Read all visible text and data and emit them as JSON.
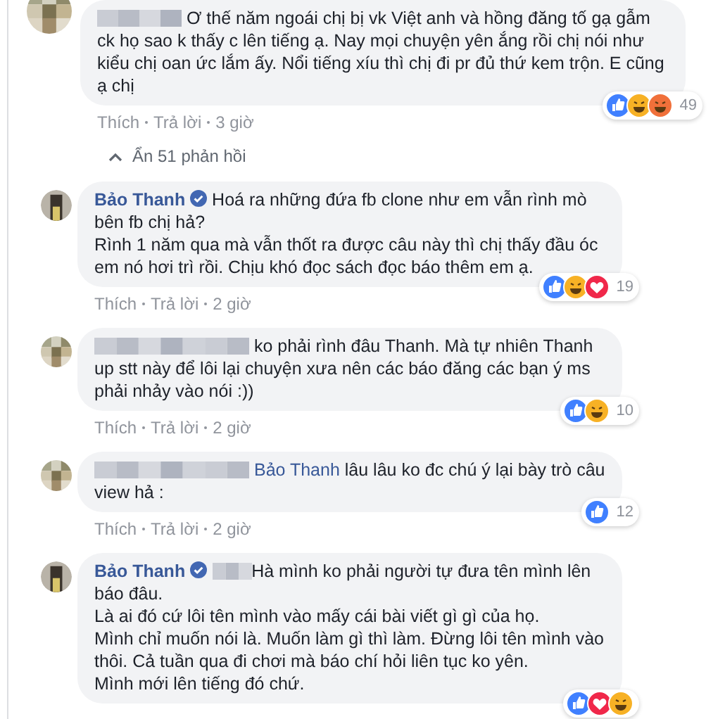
{
  "comments": [
    {
      "avatar": {
        "kind": "blurred"
      },
      "name_hidden": true,
      "verified": false,
      "text": "Ơ thế năm ngoái chị bị vk Việt anh và hồng đăng tố gạ gẫm ck họ sao k thấy c lên tiếng ạ. Nay mọi chuyện yên ắng rồi chị nói như kiểu chị oan ức lắm ấy. Nổi tiếng xíu thì chị đi pr đủ thứ kem trộn. E cũng ạ chị",
      "reactions": [
        {
          "kind": "like"
        },
        {
          "kind": "haha"
        },
        {
          "kind": "angry"
        }
      ],
      "reaction_count": "49",
      "actions": [
        "Thích",
        "Trả lời",
        "3 giờ"
      ],
      "replies_toggle": {
        "label": "Ẩn 51 phản hồi",
        "expanded": true
      },
      "children": [
        {
          "avatar": {
            "kind": "photo"
          },
          "name": "Bảo Thanh",
          "verified": true,
          "name_hidden": false,
          "text": "Hoá ra những đứa fb clone như em vẫn rình mò bên fb chị hả?\nRình 1 năm qua mà vẫn thốt ra được câu này thì chị thấy đầu óc em nó hơi trì rồi. Chịu khó đọc sách đọc báo thêm em ạ.",
          "reactions": [
            {
              "kind": "like"
            },
            {
              "kind": "haha"
            },
            {
              "kind": "love"
            }
          ],
          "reaction_count": "19",
          "actions": [
            "Thích",
            "Trả lời",
            "2 giờ"
          ]
        },
        {
          "avatar": {
            "kind": "blurred"
          },
          "name_hidden": true,
          "verified": false,
          "text": "ko phải rình đâu Thanh. Mà tự nhiên Thanh up stt này để lôi lại chuyện xưa nên các báo đăng các bạn ý ms phải nhảy vào nói :))",
          "reactions": [
            {
              "kind": "like"
            },
            {
              "kind": "haha"
            }
          ],
          "reaction_count": "10",
          "actions": [
            "Thích",
            "Trả lời",
            "2 giờ"
          ]
        },
        {
          "avatar": {
            "kind": "blurred"
          },
          "name_hidden": true,
          "verified": false,
          "mention": "Bảo Thanh",
          "text": "lâu lâu ko đc chú ý lại bày trò câu view hả :",
          "reactions": [
            {
              "kind": "like"
            }
          ],
          "reaction_count": "12",
          "actions": [
            "Thích",
            "Trả lời",
            "2 giờ"
          ]
        },
        {
          "avatar": {
            "kind": "photo"
          },
          "name": "Bảo Thanh",
          "verified": true,
          "name_hidden": false,
          "mention_hidden": true,
          "text": "Hà mình ko phải người tự đưa tên mình lên báo đâu.\nLà ai đó cứ lôi tên mình vào mấy cái bài viết gì gì của họ.\nMình chỉ muốn nói là. Muốn làm gì thì làm. Đừng lôi tên mình vào thôi. Cả tuần qua đi chơi mà báo chí hỏi liên tục ko yên.\nMình mới lên tiếng đó chứ.",
          "reactions": [
            {
              "kind": "like"
            },
            {
              "kind": "love"
            },
            {
              "kind": "haha"
            }
          ]
        }
      ]
    }
  ]
}
